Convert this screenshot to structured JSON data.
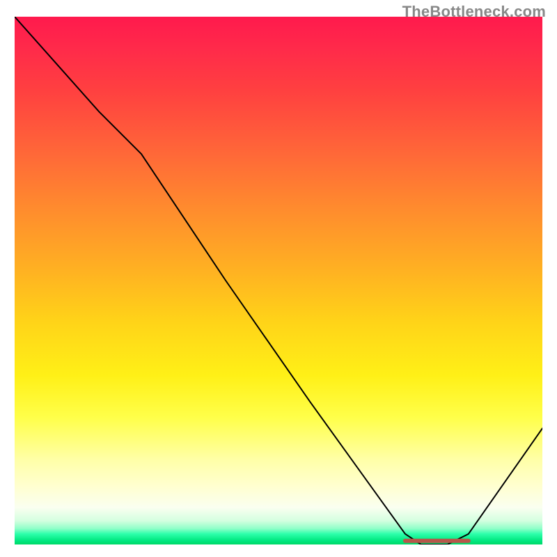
{
  "watermark": "TheBottleneck.com",
  "chart_data": {
    "type": "line",
    "title": "",
    "xlabel": "",
    "ylabel": "",
    "xlim": [
      0,
      100
    ],
    "ylim": [
      0,
      100
    ],
    "grid": false,
    "series": [
      {
        "name": "bottleneck-curve",
        "x": [
          0,
          8,
          16,
          24,
          40,
          56,
          74,
          77,
          82,
          86,
          100
        ],
        "values": [
          100,
          91,
          82,
          74,
          50,
          27,
          2,
          0,
          0,
          2,
          22
        ]
      }
    ],
    "annotations": [
      {
        "name": "optimal-band",
        "shape": "line",
        "x_start": 74,
        "x_end": 86,
        "y": 0.7,
        "color": "#b7574a"
      }
    ],
    "gradient_scale": {
      "description": "vertical background gradient from red (high bottleneck) through orange/yellow to green (optimal)",
      "stops": [
        {
          "pos": 0.0,
          "color": "#ff1a4d"
        },
        {
          "pos": 0.5,
          "color": "#ffb122"
        },
        {
          "pos": 0.78,
          "color": "#ffff4a"
        },
        {
          "pos": 0.95,
          "color": "#d4ffe0"
        },
        {
          "pos": 1.0,
          "color": "#00d768"
        }
      ]
    }
  }
}
